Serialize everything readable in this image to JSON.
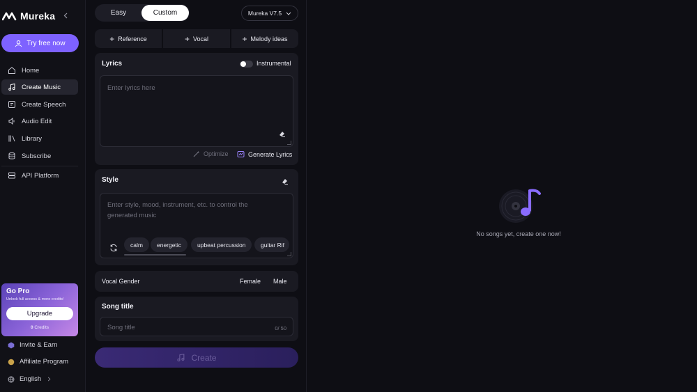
{
  "app": {
    "name": "Mureka"
  },
  "sidebar": {
    "try_label": "Try free now",
    "items": [
      {
        "label": "Home",
        "icon": "home-icon"
      },
      {
        "label": "Create Music",
        "icon": "music-note-icon",
        "active": true
      },
      {
        "label": "Create Speech",
        "icon": "speech-icon"
      },
      {
        "label": "Audio Edit",
        "icon": "audio-edit-icon"
      },
      {
        "label": "Library",
        "icon": "library-icon"
      },
      {
        "label": "Subscribe",
        "icon": "subscribe-icon"
      },
      {
        "label": "API Platform",
        "icon": "api-icon"
      }
    ],
    "gopro": {
      "title": "Go Pro",
      "subtitle": "Unlock full access & more credits!",
      "upgrade_label": "Upgrade",
      "credits_value": "0",
      "credits_label": "Credits"
    },
    "footer": {
      "invite_label": "Invite & Earn",
      "affiliate_label": "Affiliate Program",
      "language_label": "English"
    }
  },
  "form": {
    "mode_easy": "Easy",
    "mode_custom": "Custom",
    "model": "Mureka V7.5",
    "add_reference": "Reference",
    "add_vocal": "Vocal",
    "add_melody": "Melody ideas",
    "lyrics": {
      "title": "Lyrics",
      "instrumental_label": "Instrumental",
      "instrumental_on": false,
      "placeholder": "Enter lyrics here",
      "optimize_label": "Optimize",
      "generate_label": "Generate Lyrics"
    },
    "style": {
      "title": "Style",
      "placeholder_line1": "Enter style, mood, instrument, etc. to control the",
      "placeholder_line2": "generated music",
      "chips": [
        "calm",
        "energetic",
        "upbeat percussion",
        "guitar Rif"
      ]
    },
    "vocal_gender": {
      "label": "Vocal Gender",
      "female": "Female",
      "male": "Male"
    },
    "song_title": {
      "title": "Song title",
      "placeholder": "Song title",
      "counter": "0/ 50"
    },
    "create_label": "Create"
  },
  "empty_state": {
    "text": "No songs yet, create one now!"
  },
  "colors": {
    "accent": "#7e62ff",
    "background": "#0e0e14",
    "card": "#1a1a22"
  }
}
